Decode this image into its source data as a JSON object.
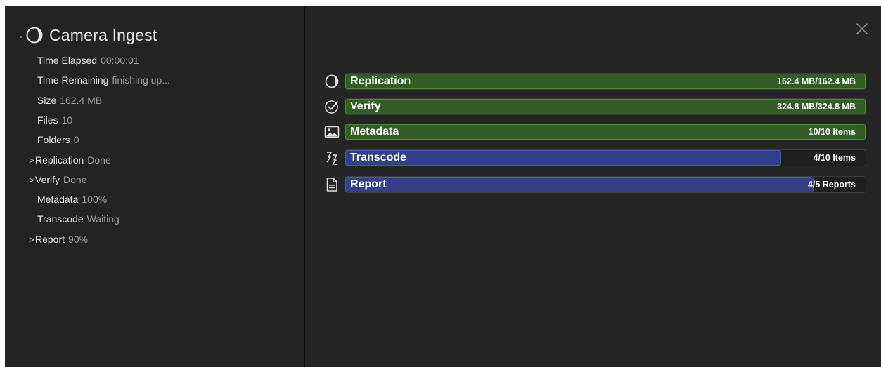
{
  "job": {
    "title": "Camera Ingest",
    "collapse_glyph": "⌄",
    "status_icon": "progress-ring-icon"
  },
  "details": [
    {
      "label": "Time Elapsed",
      "value": "00:00:01",
      "expandable": false
    },
    {
      "label": "Time Remaining",
      "value": "finishing up...",
      "expandable": false
    },
    {
      "label": "Size",
      "value": "162.4 MB",
      "expandable": false
    },
    {
      "label": "Files",
      "value": "10",
      "expandable": false
    },
    {
      "label": "Folders",
      "value": "0",
      "expandable": false
    },
    {
      "label": "Replication",
      "value": "Done",
      "expandable": true
    },
    {
      "label": "Verify",
      "value": "Done",
      "expandable": true
    },
    {
      "label": "Metadata",
      "value": "100%",
      "expandable": false
    },
    {
      "label": "Transcode",
      "value": "Waiting",
      "expandable": false
    },
    {
      "label": "Report",
      "value": "90%",
      "expandable": true
    }
  ],
  "expand_glyph": ">",
  "tasks": [
    {
      "name": "Replication",
      "amount": "162.4 MB/162.4 MB",
      "progress": 1.0,
      "color": "#345c27",
      "icon": "replication-ring-icon"
    },
    {
      "name": "Verify",
      "amount": "324.8 MB/324.8 MB",
      "progress": 1.0,
      "color": "#345c27",
      "icon": "checkmark-circle-icon"
    },
    {
      "name": "Metadata",
      "amount": "10/10 Items",
      "progress": 1.0,
      "color": "#345c27",
      "icon": "image-icon"
    },
    {
      "name": "Transcode",
      "amount": "4/10 Items",
      "progress": 0.838,
      "color": "#333f86",
      "icon": "transcode-arrows-icon"
    },
    {
      "name": "Report",
      "amount": "4/5 Reports",
      "progress": 0.9,
      "color": "#333f86",
      "icon": "document-icon"
    }
  ],
  "colors": {
    "complete": "#345c27",
    "in_progress": "#333f86",
    "background": "#252525"
  },
  "close_icon": "close-icon"
}
